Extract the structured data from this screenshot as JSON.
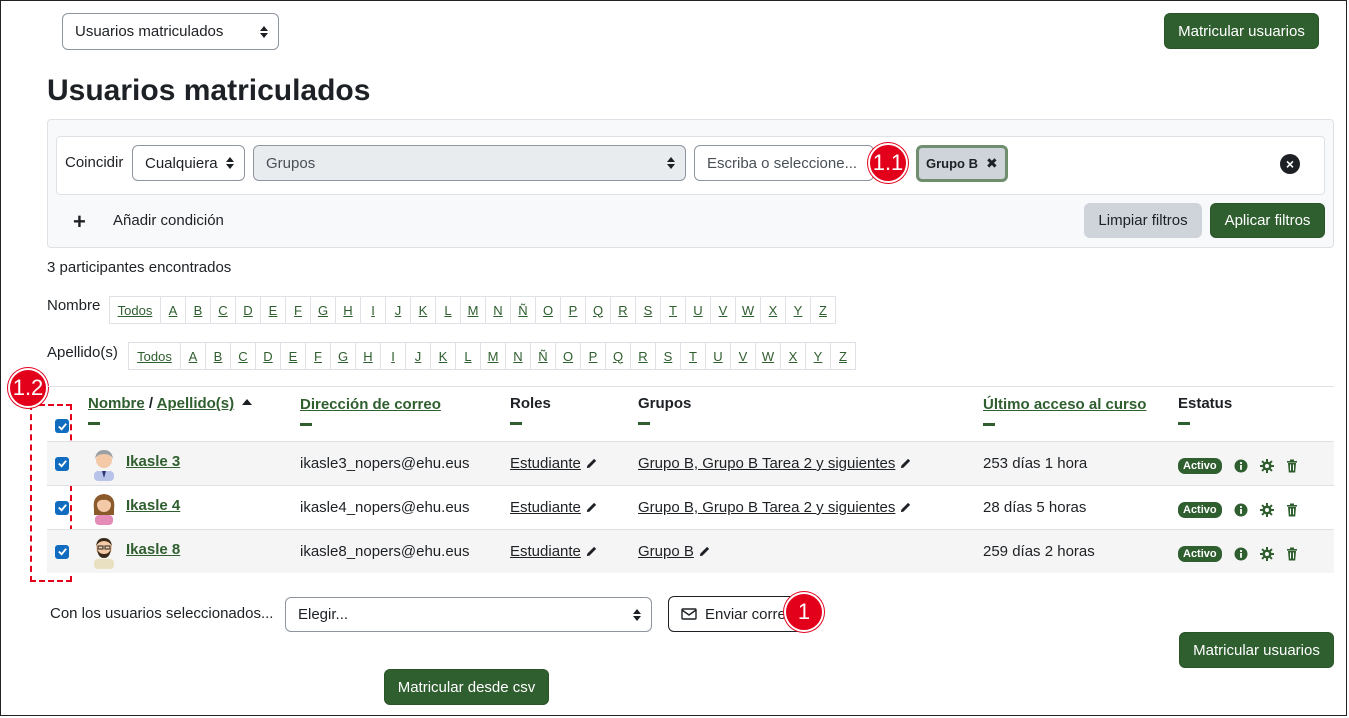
{
  "top": {
    "view_select": "Usuarios matriculados",
    "enrol_button": "Matricular usuarios"
  },
  "page_title": "Usuarios matriculados",
  "filter": {
    "match_label": "Coincidir",
    "match_select": "Cualquiera",
    "type_select": "Grupos",
    "value_placeholder": "Escriba o seleccione...",
    "chip_label": "Grupo B",
    "chip_remove": "✖",
    "add_condition": "Añadir condición",
    "clear_button": "Limpiar filtros",
    "apply_button": "Aplicar filtros"
  },
  "annotations": {
    "a1": "1",
    "a11": "1.1",
    "a12": "1.2"
  },
  "participants_found": "3 participantes encontrados",
  "initials": {
    "first_label": "Nombre",
    "last_label": "Apellido(s)",
    "all": "Todos",
    "letters": [
      "A",
      "B",
      "C",
      "D",
      "E",
      "F",
      "G",
      "H",
      "I",
      "J",
      "K",
      "L",
      "M",
      "N",
      "Ñ",
      "O",
      "P",
      "Q",
      "R",
      "S",
      "T",
      "U",
      "V",
      "W",
      "X",
      "Y",
      "Z"
    ]
  },
  "table": {
    "headers": {
      "first_name": "Nombre",
      "separator": " / ",
      "last_name": "Apellido(s)",
      "email": "Dirección de correo",
      "roles": "Roles",
      "groups": "Grupos",
      "last_access": "Último acceso al curso",
      "status": "Estatus"
    },
    "rows": [
      {
        "name": "Ikasle 3",
        "email": "ikasle3_nopers@ehu.eus",
        "role": "Estudiante",
        "groups": "Grupo B, Grupo B Tarea 2 y siguientes",
        "last_access": "253 días 1 hora",
        "status": "Activo",
        "avatar": "man-grey-hair"
      },
      {
        "name": "Ikasle 4",
        "email": "ikasle4_nopers@ehu.eus",
        "role": "Estudiante",
        "groups": "Grupo B, Grupo B Tarea 2 y siguientes",
        "last_access": "28 días 5 horas",
        "status": "Activo",
        "avatar": "woman-brown-hair"
      },
      {
        "name": "Ikasle 8",
        "email": "ikasle8_nopers@ehu.eus",
        "role": "Estudiante",
        "groups": "Grupo B",
        "last_access": "259 días 2 horas",
        "status": "Activo",
        "avatar": "man-beard"
      }
    ]
  },
  "bulk": {
    "label": "Con los usuarios seleccionados...",
    "select": "Elegir...",
    "send_message": "Enviar correo"
  },
  "bottom": {
    "enrol_button": "Matricular usuarios",
    "csv_button": "Matricular desde csv"
  },
  "colors": {
    "primary": "#2f5e2f",
    "annotation": "#e2001a",
    "checkbox": "#0f6cbf"
  }
}
